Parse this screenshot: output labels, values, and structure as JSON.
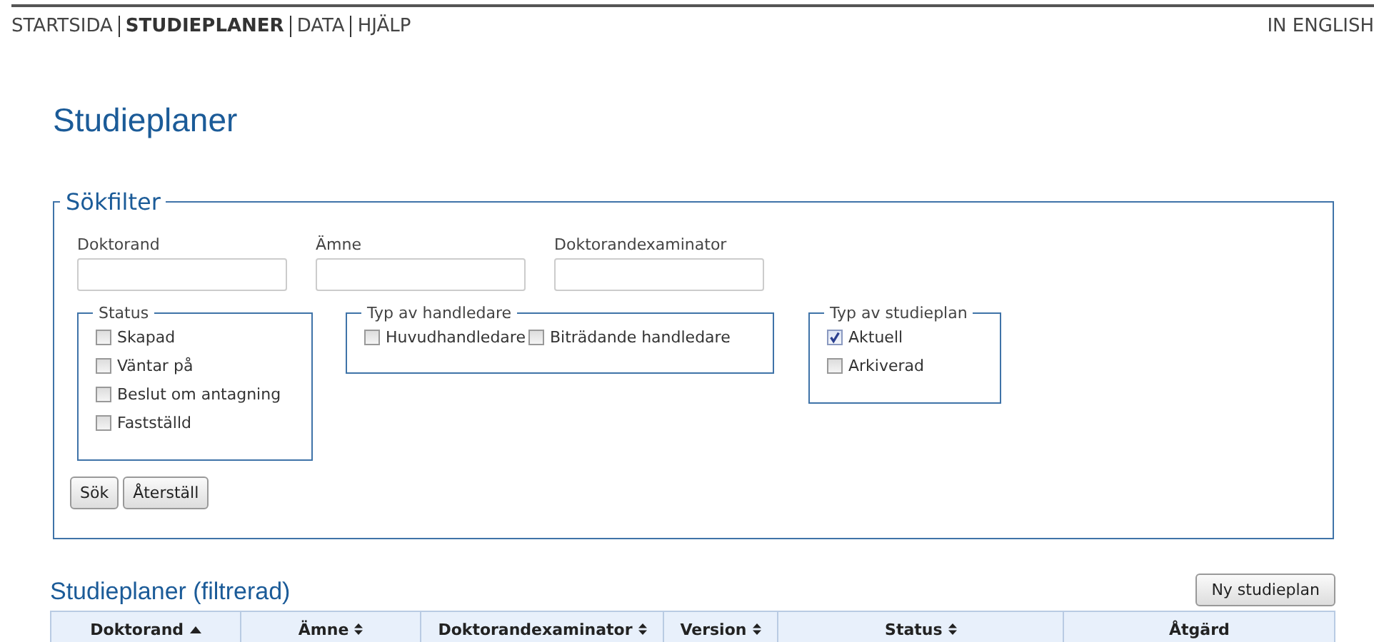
{
  "nav": {
    "items": [
      {
        "label": "STARTSIDA",
        "selected": false
      },
      {
        "label": "STUDIEPLANER",
        "selected": true
      },
      {
        "label": "DATA",
        "selected": false
      },
      {
        "label": "HJÄLP",
        "selected": false
      }
    ],
    "language_link": "IN ENGLISH"
  },
  "page_title": "Studieplaner",
  "search_filter": {
    "legend": "Sökfilter",
    "fields": [
      {
        "label": "Doktorand"
      },
      {
        "label": "Ämne"
      },
      {
        "label": "Doktorandexaminator"
      }
    ],
    "groups": [
      {
        "legend": "Status",
        "kind": "column",
        "options": [
          {
            "label": "Skapad",
            "checked": false
          },
          {
            "label": "Väntar på",
            "checked": false
          },
          {
            "label": "Beslut om antagning",
            "checked": false
          },
          {
            "label": "Fastställd",
            "checked": false
          }
        ]
      },
      {
        "legend": "Typ av handledare",
        "kind": "row",
        "options": [
          {
            "label": "Huvudhandledare",
            "checked": false
          },
          {
            "label": "Biträdande handledare",
            "checked": false
          }
        ]
      },
      {
        "legend": "Typ av studieplan",
        "kind": "column",
        "options": [
          {
            "label": "Aktuell",
            "checked": true
          },
          {
            "label": "Arkiverad",
            "checked": false
          }
        ]
      }
    ],
    "buttons": [
      "Sök",
      "Återställ"
    ]
  },
  "results": {
    "title": "Studieplaner (filtrerad)",
    "new_button": "Ny studieplan",
    "columns": [
      {
        "label": "Doktorand",
        "sortable": true,
        "sorted": true
      },
      {
        "label": "Ämne",
        "sortable": true,
        "sorted": false
      },
      {
        "label": "Doktorandexaminator",
        "sortable": true,
        "sorted": false
      },
      {
        "label": "Version",
        "sortable": true,
        "sorted": false
      },
      {
        "label": "Status",
        "sortable": true,
        "sorted": false
      },
      {
        "label": "Åtgärd",
        "sortable": false,
        "sorted": false
      }
    ]
  }
}
